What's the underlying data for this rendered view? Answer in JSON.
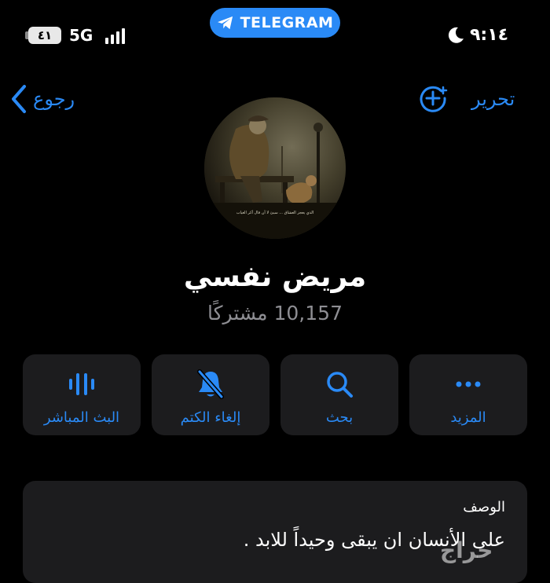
{
  "status_bar": {
    "battery": "٤١",
    "network": "5G",
    "banner": "TELEGRAM",
    "time": "٩:١٤"
  },
  "nav": {
    "back_label": "رجوع",
    "edit_label": "تحرير"
  },
  "channel": {
    "name": "مريض نفسي",
    "subscribers": "10,157 مشتركًا",
    "avatar_caption": "الذي يعجز العشاق ... سيئ لا أن فال أكر الغياب"
  },
  "actions": [
    {
      "label": "البث المباشر",
      "icon": "voice-chat-icon"
    },
    {
      "label": "إلغاء الكتم",
      "icon": "bell-slash-icon"
    },
    {
      "label": "بحث",
      "icon": "search-icon"
    },
    {
      "label": "المزيد",
      "icon": "more-icon"
    }
  ],
  "description": {
    "label": "الوصف",
    "text": "على الأنسان ان يبقى وحيداً للابد ."
  },
  "watermark": "حراج",
  "colors": {
    "accent": "#2a8af6",
    "background": "#000000",
    "card": "#1c1c1e",
    "secondary_text": "#8e8e93"
  }
}
